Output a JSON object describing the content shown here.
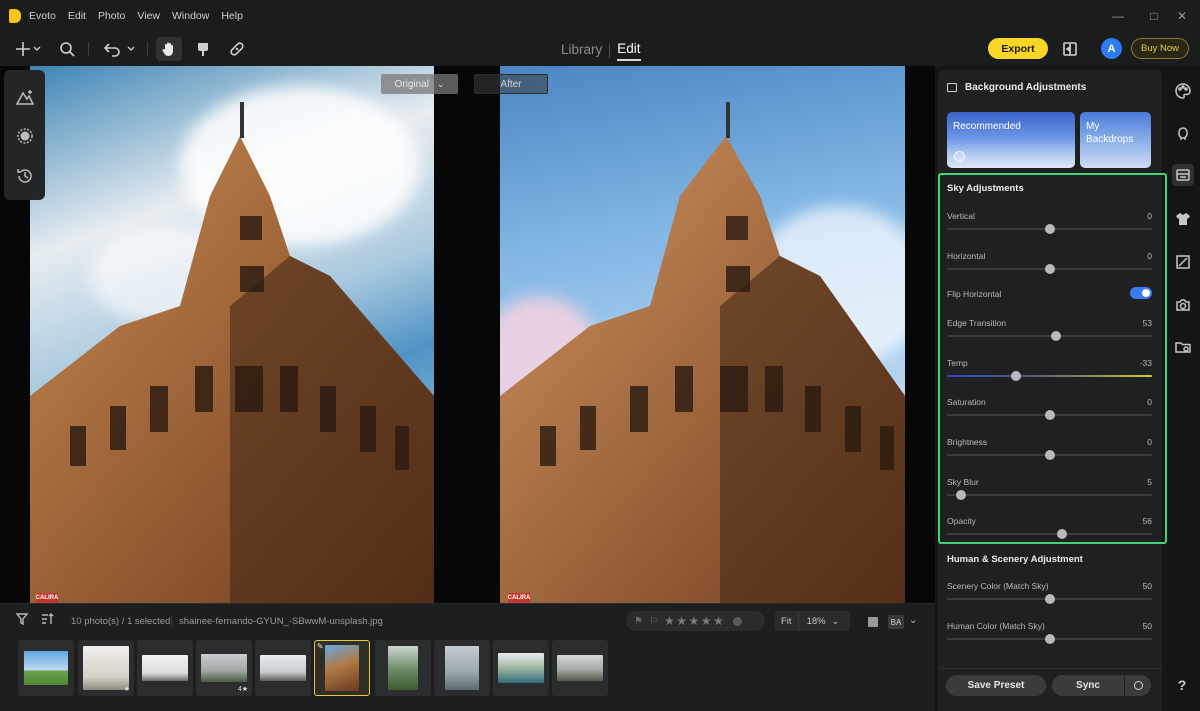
{
  "app": {
    "name": "Evoto",
    "menu": [
      "Edit",
      "Photo",
      "View",
      "Window",
      "Help"
    ]
  },
  "toolbar": {
    "tabs": {
      "library": "Library",
      "edit": "Edit"
    },
    "export_label": "Export",
    "avatar_letter": "A",
    "buy_now_label": "Buy Now"
  },
  "canvas": {
    "original_label": "Original",
    "after_label": "After",
    "watermark": "CALIRA"
  },
  "filmstrip": {
    "photo_count": "10 photo(s) / 1 selected",
    "filename": "shainee-fernando-GYUN_-SBwwM-unsplash.jpg",
    "zoom_fit": "Fit",
    "zoom_value": "18%",
    "view_ba": "BA",
    "thumb_badges": {
      "t1": "★",
      "t3": "4★"
    }
  },
  "panel": {
    "title": "Background Adjustments",
    "cards": {
      "recommended": "Recommended",
      "my_backdrops": "My Backdrops"
    },
    "sky": {
      "title": "Sky Adjustments",
      "vertical": {
        "label": "Vertical",
        "value": "0",
        "pos": 0.5
      },
      "horizontal": {
        "label": "Horizontal",
        "value": "0",
        "pos": 0.5
      },
      "flip": {
        "label": "Flip Horizontal",
        "on": true
      },
      "edge": {
        "label": "Edge Transition",
        "value": "53",
        "pos": 0.53
      },
      "temp": {
        "label": "Temp",
        "value": "-33",
        "pos": 0.335
      },
      "saturation": {
        "label": "Saturation",
        "value": "0",
        "pos": 0.5
      },
      "brightness": {
        "label": "Brightness",
        "value": "0",
        "pos": 0.5
      },
      "blur": {
        "label": "Sky Blur",
        "value": "5",
        "pos": 0.07
      },
      "opacity": {
        "label": "Opacity",
        "value": "56",
        "pos": 0.56
      }
    },
    "human": {
      "title": "Human & Scenery Adjustment",
      "scenery": {
        "label": "Scenery Color (Match Sky)",
        "value": "50",
        "pos": 0.5
      },
      "human_color": {
        "label": "Human Color (Match Sky)",
        "value": "50",
        "pos": 0.5
      }
    },
    "buttons": {
      "save_preset": "Save Preset",
      "sync": "Sync"
    }
  },
  "icons": [
    "add-icon",
    "search-icon",
    "undo-icon",
    "hand-icon",
    "brush-icon",
    "bandage-icon",
    "compare-icon",
    "portrait-icon",
    "mask-icon",
    "history-icon",
    "palette-icon",
    "face-icon",
    "background-icon",
    "shirt-icon",
    "crop-icon",
    "camera-icon",
    "folder-icon",
    "help-icon"
  ],
  "colors": {
    "accent_yellow": "#f7d628",
    "highlight_green": "#3dd47a",
    "toggle_blue": "#3a7cf0",
    "avatar_blue": "#2f7bf2"
  }
}
